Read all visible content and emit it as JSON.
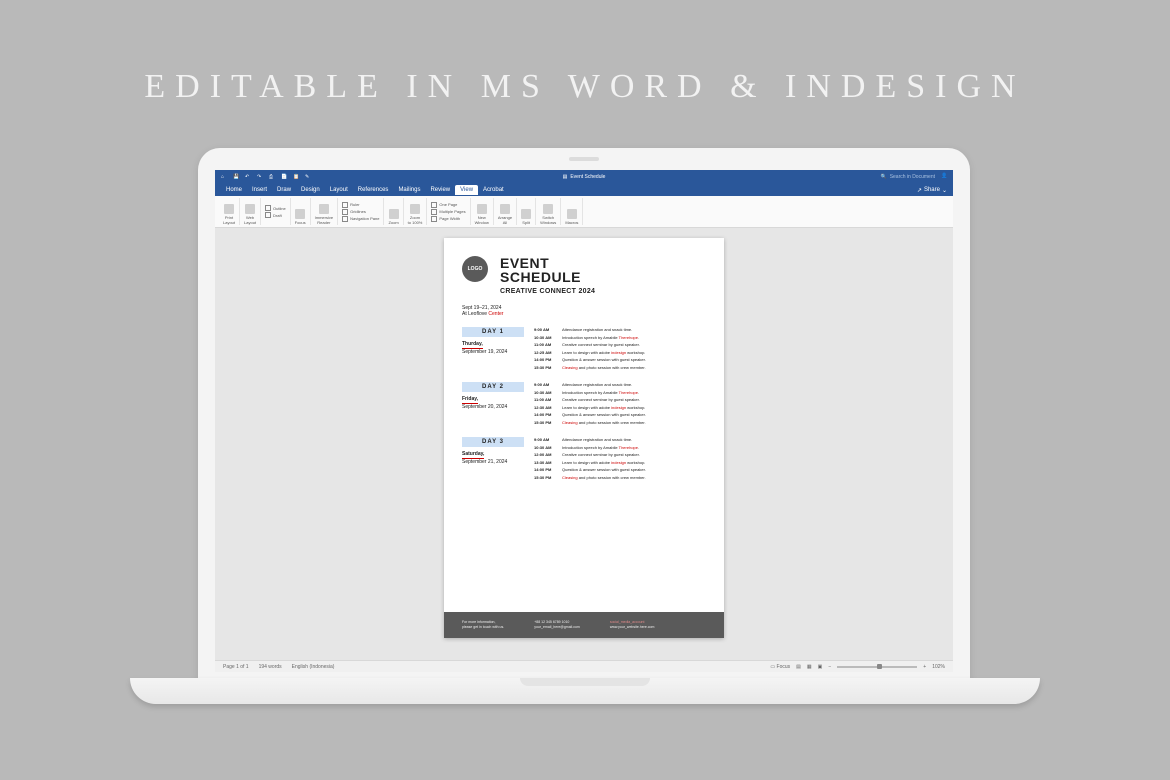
{
  "heading": "EDITABLE IN MS WORD & INDESIGN",
  "titlebar": {
    "doc_title": "Event Schedule",
    "search_placeholder": "Search in Document"
  },
  "menubar": {
    "tabs": [
      "Home",
      "Insert",
      "Draw",
      "Design",
      "Layout",
      "References",
      "Mailings",
      "Review",
      "View",
      "Acrobat"
    ],
    "active_index": 8,
    "share": "Share"
  },
  "ribbon": {
    "print_layout": "Print\nLayout",
    "web_layout": "Web\nLayout",
    "outline": "Outline",
    "draft": "Draft",
    "focus": "Focus",
    "immersive": "Immersive\nReader",
    "ruler": "Ruler",
    "gridlines": "Gridlines",
    "nav_pane": "Navigation Pane",
    "zoom": "Zoom",
    "zoom100": "Zoom\nto 100%",
    "one_page": "One Page",
    "multiple": "Multiple Pages",
    "page_width": "Page Width",
    "new_window": "New\nWindow",
    "arrange": "Arrange\nAll",
    "split": "Split",
    "switch": "Switch\nWindows",
    "macros": "Macros"
  },
  "document": {
    "logo": "LOGO",
    "title_line1": "EVENT",
    "title_line2": "SCHEDULE",
    "subtitle": "CREATIVE CONNECT 2024",
    "event_info_line1": "Sept 19–21, 2024",
    "event_info_line2_a": "At Leoflove ",
    "event_info_line2_b": "Center",
    "days": [
      {
        "tag": "DAY 1",
        "dayname": "Thurday,",
        "date": "September 19, 2024",
        "rows": [
          {
            "time": "9:00 AM",
            "desc": "Attendance registration and snack time."
          },
          {
            "time": "10:30 AM",
            "desc": "Introduction speech by Amabile Therehope."
          },
          {
            "time": "11:00 AM",
            "desc": "Creative connect seminar by guest speaker."
          },
          {
            "time": "12:25 AM",
            "desc": "Learn to design with adobe indesign workshop."
          },
          {
            "time": "14:00 PM",
            "desc": "Question & answer session with guest speaker."
          },
          {
            "time": "15:30 PM",
            "desc": "Cleasing and photo session with crew member."
          }
        ]
      },
      {
        "tag": "DAY 2",
        "dayname": "Friday,",
        "date": "September 20, 2024",
        "rows": [
          {
            "time": "9:00 AM",
            "desc": "Attendance registration and snack time."
          },
          {
            "time": "10:30 AM",
            "desc": "Introduction speech by Amabile Therehope."
          },
          {
            "time": "11:00 AM",
            "desc": "Creative connect seminar by guest speaker."
          },
          {
            "time": "12:30 AM",
            "desc": "Learn to design with adobe indesign workshop."
          },
          {
            "time": "14:00 PM",
            "desc": "Question & answer session with guest speaker."
          },
          {
            "time": "15:30 PM",
            "desc": "Cleasing and photo session with crew member."
          }
        ]
      },
      {
        "tag": "DAY 3",
        "dayname": "Saturday,",
        "date": "September 21, 2024",
        "rows": [
          {
            "time": "9:00 AM",
            "desc": "Attendance registration and snack time."
          },
          {
            "time": "10:30 AM",
            "desc": "Introduction speech by Amabile Therehope."
          },
          {
            "time": "12:00 AM",
            "desc": "Creative connect seminar by guest speaker."
          },
          {
            "time": "13:30 AM",
            "desc": "Learn to design with adobe indesign workshop."
          },
          {
            "time": "14:00 PM",
            "desc": "Question & answer session with guest speaker."
          },
          {
            "time": "15:30 PM",
            "desc": "Cleasing and photo session with crew member."
          }
        ]
      }
    ],
    "footer": {
      "col1a": "For more information,",
      "col1b": "please get in touch with us.",
      "col2a": "+88 12 345 6789 1010",
      "col2b": "your_email_here@gmail.com",
      "col3a": "social_media_account",
      "col3b": "www.your_website.here.com"
    }
  },
  "statusbar": {
    "page": "Page 1 of 1",
    "words": "194 words",
    "lang": "English (Indonesia)",
    "focus": "Focus",
    "zoom": "102%"
  }
}
